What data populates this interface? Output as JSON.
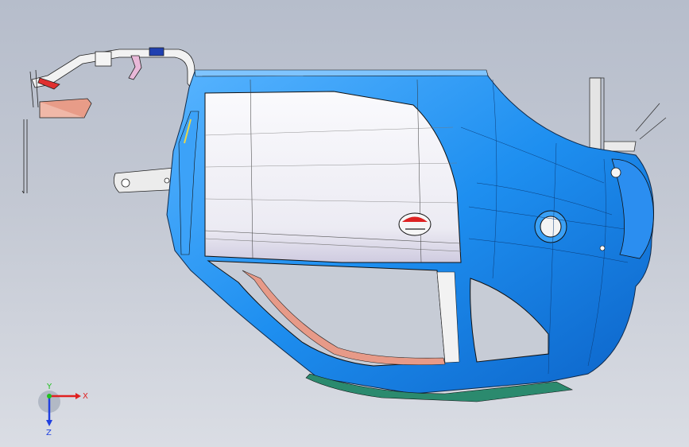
{
  "viewport": {
    "background_top": "#b6bdcb",
    "background_bottom": "#dadde4"
  },
  "model": {
    "body_color": "#1e8ff0",
    "panel_color": "#f4f4f8",
    "seal_color": "#e09a8a",
    "sill_color": "#2b8a6e",
    "edge_color": "#1a1a1a"
  },
  "triad": {
    "x_label": "X",
    "y_label": "Y",
    "z_label": "Z",
    "x_color": "#e02020",
    "y_color": "#20c020",
    "z_color": "#2040e0"
  }
}
